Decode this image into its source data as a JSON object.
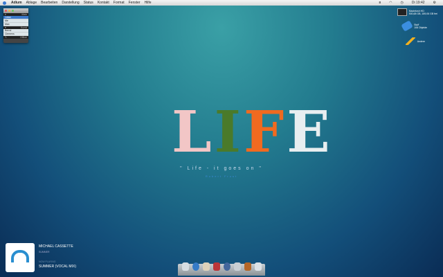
{
  "menubar": {
    "items": [
      "Adium",
      "Ablage",
      "Bearbeiten",
      "Darstellung",
      "Status",
      "Kontakt",
      "Format",
      "Fenster",
      "Hilfe"
    ],
    "clock": "Di 19:42"
  },
  "adium": {
    "groups": [
      {
        "name": "Main",
        "contacts": [
          "Julian",
          "Me",
          "Max"
        ]
      },
      {
        "name": "Kunst",
        "contacts": [
          "Bernd",
          "Clemens"
        ]
      }
    ],
    "footer": "Offline"
  },
  "desktop_icons": [
    {
      "name": "Macintosh HD",
      "sub": "500,68 GB, 189,06 GB frei",
      "icon": "hard-drive-icon"
    },
    {
      "name": "Stuff",
      "sub": "108 Objekte",
      "icon": "folder-tag-icon"
    },
    {
      "name": "Andere",
      "sub": "",
      "icon": "pencil-icon"
    }
  ],
  "wallpaper": {
    "title": "LIFE",
    "quote": "\" Life - it goes on \"",
    "author": "Robert Frost"
  },
  "now_playing": {
    "artist": "MICHAEL CASSETTE",
    "album": "SUMMER",
    "label": "NOW PLAYING",
    "track": "SUMMER (VOCAL MIX)"
  },
  "dock": {
    "items": [
      "finder-icon",
      "safari-icon",
      "mail-icon",
      "system-prefs-icon",
      "itunes-icon",
      "adium-icon",
      "app-icon",
      "trash-icon"
    ]
  }
}
